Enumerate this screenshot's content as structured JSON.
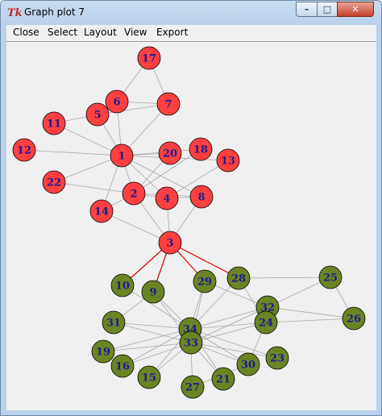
{
  "window": {
    "app_icon": "Tk",
    "title": "Graph plot 7",
    "buttons": {
      "minimize": "minimize-icon",
      "maximize": "maximize-icon",
      "close": "close-icon"
    }
  },
  "menu": [
    "Close",
    "Select",
    "Layout",
    "View",
    "Export"
  ],
  "colors": {
    "red_node": "#ff4040",
    "green_node": "#6b8423",
    "highlight_edge": "#d40000",
    "edge": "#a8a8a8",
    "label": "#1b1b8f",
    "canvas": "#f0f0f0"
  },
  "graph": {
    "nodes": [
      {
        "id": "17",
        "group": "red"
      },
      {
        "id": "6",
        "group": "red"
      },
      {
        "id": "7",
        "group": "red"
      },
      {
        "id": "5",
        "group": "red"
      },
      {
        "id": "11",
        "group": "red"
      },
      {
        "id": "12",
        "group": "red"
      },
      {
        "id": "1",
        "group": "red"
      },
      {
        "id": "20",
        "group": "red"
      },
      {
        "id": "18",
        "group": "red"
      },
      {
        "id": "13",
        "group": "red"
      },
      {
        "id": "22",
        "group": "red"
      },
      {
        "id": "2",
        "group": "red"
      },
      {
        "id": "4",
        "group": "red"
      },
      {
        "id": "8",
        "group": "red"
      },
      {
        "id": "14",
        "group": "red"
      },
      {
        "id": "3",
        "group": "red"
      },
      {
        "id": "10",
        "group": "green"
      },
      {
        "id": "9",
        "group": "green"
      },
      {
        "id": "29",
        "group": "green"
      },
      {
        "id": "28",
        "group": "green"
      },
      {
        "id": "25",
        "group": "green"
      },
      {
        "id": "32",
        "group": "green"
      },
      {
        "id": "24",
        "group": "green"
      },
      {
        "id": "26",
        "group": "green"
      },
      {
        "id": "31",
        "group": "green"
      },
      {
        "id": "34",
        "group": "green"
      },
      {
        "id": "33",
        "group": "green"
      },
      {
        "id": "19",
        "group": "green"
      },
      {
        "id": "16",
        "group": "green"
      },
      {
        "id": "15",
        "group": "green"
      },
      {
        "id": "27",
        "group": "green"
      },
      {
        "id": "21",
        "group": "green"
      },
      {
        "id": "30",
        "group": "green"
      },
      {
        "id": "23",
        "group": "green"
      }
    ],
    "edges": [
      [
        "17",
        "6"
      ],
      [
        "17",
        "7"
      ],
      [
        "6",
        "7"
      ],
      [
        "6",
        "5"
      ],
      [
        "6",
        "1"
      ],
      [
        "7",
        "1"
      ],
      [
        "5",
        "1"
      ],
      [
        "5",
        "11"
      ],
      [
        "5",
        "7"
      ],
      [
        "11",
        "1"
      ],
      [
        "12",
        "1"
      ],
      [
        "1",
        "20"
      ],
      [
        "1",
        "18"
      ],
      [
        "1",
        "22"
      ],
      [
        "1",
        "2"
      ],
      [
        "1",
        "4"
      ],
      [
        "1",
        "8"
      ],
      [
        "1",
        "14"
      ],
      [
        "1",
        "13"
      ],
      [
        "2",
        "20"
      ],
      [
        "2",
        "18"
      ],
      [
        "2",
        "14"
      ],
      [
        "2",
        "4"
      ],
      [
        "2",
        "3"
      ],
      [
        "2",
        "8"
      ],
      [
        "2",
        "22"
      ],
      [
        "4",
        "8"
      ],
      [
        "4",
        "13"
      ],
      [
        "4",
        "3"
      ],
      [
        "14",
        "3"
      ],
      [
        "8",
        "3"
      ],
      [
        "3",
        "10",
        "h"
      ],
      [
        "3",
        "9",
        "h"
      ],
      [
        "3",
        "29",
        "h"
      ],
      [
        "3",
        "28",
        "h"
      ],
      [
        "9",
        "34"
      ],
      [
        "9",
        "33"
      ],
      [
        "9",
        "31"
      ],
      [
        "29",
        "34"
      ],
      [
        "29",
        "33"
      ],
      [
        "28",
        "34"
      ],
      [
        "28",
        "25"
      ],
      [
        "28",
        "24"
      ],
      [
        "25",
        "32"
      ],
      [
        "25",
        "26"
      ],
      [
        "32",
        "34"
      ],
      [
        "32",
        "33"
      ],
      [
        "32",
        "29"
      ],
      [
        "24",
        "34"
      ],
      [
        "24",
        "33"
      ],
      [
        "24",
        "30"
      ],
      [
        "24",
        "26"
      ],
      [
        "26",
        "32"
      ],
      [
        "31",
        "34"
      ],
      [
        "31",
        "33"
      ],
      [
        "19",
        "34"
      ],
      [
        "19",
        "33"
      ],
      [
        "16",
        "34"
      ],
      [
        "16",
        "33"
      ],
      [
        "15",
        "34"
      ],
      [
        "15",
        "33"
      ],
      [
        "27",
        "34"
      ],
      [
        "27",
        "30"
      ],
      [
        "21",
        "34"
      ],
      [
        "21",
        "33"
      ],
      [
        "30",
        "34"
      ],
      [
        "30",
        "33"
      ],
      [
        "23",
        "34"
      ],
      [
        "23",
        "33"
      ],
      [
        "10",
        "34"
      ],
      [
        "33",
        "34"
      ]
    ]
  }
}
